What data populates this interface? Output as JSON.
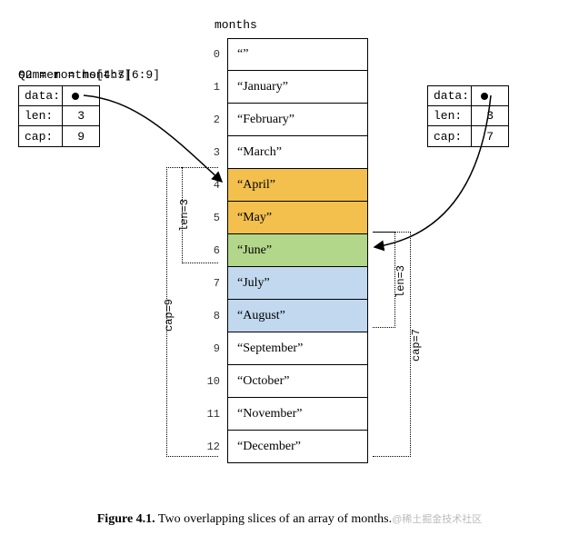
{
  "array": {
    "title": "months",
    "cells": [
      {
        "idx": "0",
        "val": "“”",
        "class": ""
      },
      {
        "idx": "1",
        "val": "“January”",
        "class": ""
      },
      {
        "idx": "2",
        "val": "“February”",
        "class": ""
      },
      {
        "idx": "3",
        "val": "“March”",
        "class": ""
      },
      {
        "idx": "4",
        "val": "“April”",
        "class": "orange"
      },
      {
        "idx": "5",
        "val": "“May”",
        "class": "orange"
      },
      {
        "idx": "6",
        "val": "“June”",
        "class": "green"
      },
      {
        "idx": "7",
        "val": "“July”",
        "class": "blue"
      },
      {
        "idx": "8",
        "val": "“August”",
        "class": "blue"
      },
      {
        "idx": "9",
        "val": "“September”",
        "class": ""
      },
      {
        "idx": "10",
        "val": "“October”",
        "class": ""
      },
      {
        "idx": "11",
        "val": "“November”",
        "class": ""
      },
      {
        "idx": "12",
        "val": "“December”",
        "class": ""
      }
    ]
  },
  "slice_left": {
    "title": "Q2 = months[4:7]",
    "data_label": "data:",
    "len_label": "len:",
    "len_val": "3",
    "cap_label": "cap:",
    "cap_val": "9"
  },
  "slice_right": {
    "title": "summer = months[6:9]",
    "data_label": "data:",
    "len_label": "len:",
    "len_val": "3",
    "cap_label": "cap:",
    "cap_val": "7"
  },
  "brackets": {
    "left_len": "len=3",
    "left_cap": "cap=9",
    "right_len": "len=3",
    "right_cap": "cap=7"
  },
  "caption": {
    "fig": "Figure 4.1.",
    "text": "  Two overlapping slices of an array of months."
  },
  "watermark": "@稀土掘金技术社区"
}
